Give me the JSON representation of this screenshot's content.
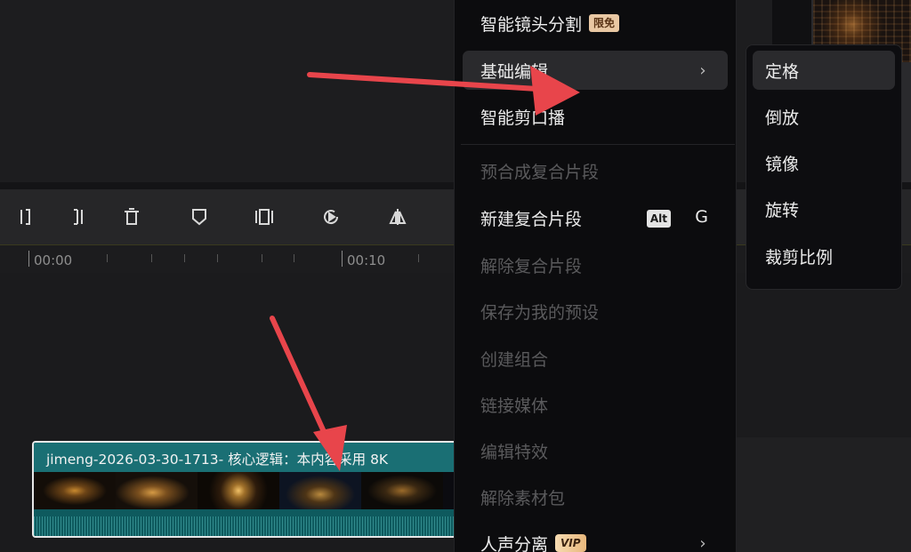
{
  "timeline": {
    "ruler_labels": [
      "00:00",
      "00:10"
    ],
    "clip_title": "jimeng-2026-03-30-1713- 核心逻辑：本内容采用 8K"
  },
  "toolbar": {
    "tools": [
      "split-left-icon",
      "split-right-icon",
      "delete-icon",
      "marker-icon",
      "freeze-frame-icon",
      "speed-icon",
      "mirror-icon"
    ]
  },
  "context_menu": {
    "smart_scene_cut": {
      "label": "智能镜头分割",
      "badge": "限免"
    },
    "basic_edit": {
      "label": "基础编辑",
      "chevron": "›"
    },
    "smart_mouth_cut": {
      "label": "智能剪口播"
    },
    "precompose": {
      "label": "预合成复合片段"
    },
    "new_compound": {
      "label": "新建复合片段",
      "shortcut_mod": "Alt",
      "shortcut_key": "G"
    },
    "release_compound": {
      "label": "解除复合片段"
    },
    "save_preset": {
      "label": "保存为我的预设"
    },
    "create_group": {
      "label": "创建组合"
    },
    "link_media": {
      "label": "链接媒体"
    },
    "edit_effects": {
      "label": "编辑特效"
    },
    "release_pack": {
      "label": "解除素材包"
    },
    "voice_separation": {
      "label": "人声分离",
      "badge": "VIP",
      "chevron": "›"
    }
  },
  "submenu": {
    "items": [
      "定格",
      "倒放",
      "镜像",
      "旋转",
      "裁剪比例"
    ]
  },
  "colors": {
    "annotation_arrow": "#e8454b",
    "clip_header": "#1a6f74",
    "menu_bg": "#0c0c0e",
    "menu_hover": "#2a2a2d"
  }
}
